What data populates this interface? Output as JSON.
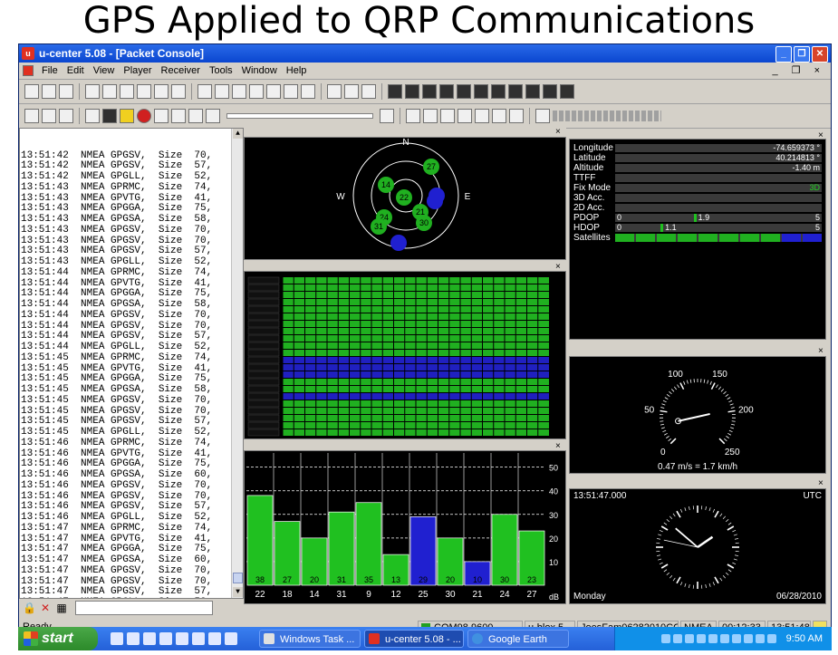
{
  "slide": {
    "title": "GPS Applied to QRP Communications"
  },
  "window": {
    "title": "u-center 5.08 - [Packet Console]",
    "app_icon": "u",
    "buttons": [
      "_",
      "❐",
      "✕"
    ],
    "menu": [
      "File",
      "Edit",
      "View",
      "Player",
      "Receiver",
      "Tools",
      "Window",
      "Help"
    ],
    "mdi_controls": "_ ❐ ×"
  },
  "console": {
    "lines": [
      "13:51:42  NMEA GPGSV,  Size  70,",
      "13:51:42  NMEA GPGSV,  Size  57,",
      "13:51:42  NMEA GPGLL,  Size  52,",
      "13:51:43  NMEA GPRMC,  Size  74,",
      "13:51:43  NMEA GPVTG,  Size  41,",
      "13:51:43  NMEA GPGGA,  Size  75,",
      "13:51:43  NMEA GPGSA,  Size  58,",
      "13:51:43  NMEA GPGSV,  Size  70,",
      "13:51:43  NMEA GPGSV,  Size  70,",
      "13:51:43  NMEA GPGSV,  Size  57,",
      "13:51:43  NMEA GPGLL,  Size  52,",
      "13:51:44  NMEA GPRMC,  Size  74,",
      "13:51:44  NMEA GPVTG,  Size  41,",
      "13:51:44  NMEA GPGGA,  Size  75,",
      "13:51:44  NMEA GPGSA,  Size  58,",
      "13:51:44  NMEA GPGSV,  Size  70,",
      "13:51:44  NMEA GPGSV,  Size  70,",
      "13:51:44  NMEA GPGSV,  Size  57,",
      "13:51:44  NMEA GPGLL,  Size  52,",
      "13:51:45  NMEA GPRMC,  Size  74,",
      "13:51:45  NMEA GPVTG,  Size  41,",
      "13:51:45  NMEA GPGGA,  Size  75,",
      "13:51:45  NMEA GPGSA,  Size  58,",
      "13:51:45  NMEA GPGSV,  Size  70,",
      "13:51:45  NMEA GPGSV,  Size  70,",
      "13:51:45  NMEA GPGSV,  Size  57,",
      "13:51:45  NMEA GPGLL,  Size  52,",
      "13:51:46  NMEA GPRMC,  Size  74,",
      "13:51:46  NMEA GPVTG,  Size  41,",
      "13:51:46  NMEA GPGGA,  Size  75,",
      "13:51:46  NMEA GPGSA,  Size  60,",
      "13:51:46  NMEA GPGSV,  Size  70,",
      "13:51:46  NMEA GPGSV,  Size  70,",
      "13:51:46  NMEA GPGSV,  Size  57,",
      "13:51:46  NMEA GPGLL,  Size  52,",
      "13:51:47  NMEA GPRMC,  Size  74,",
      "13:51:47  NMEA GPVTG,  Size  41,",
      "13:51:47  NMEA GPGGA,  Size  75,",
      "13:51:47  NMEA GPGSA,  Size  60,",
      "13:51:47  NMEA GPGSV,  Size  70,",
      "13:51:47  NMEA GPGSV,  Size  70,",
      "13:51:47  NMEA GPGSV,  Size  57,",
      "13:51:47  NMEA GPGLL,  Size  52,"
    ]
  },
  "skyview": {
    "directions": [
      "N",
      "E",
      "W"
    ],
    "satellites": [
      {
        "id": "27",
        "color": "#20b020"
      },
      {
        "id": "14",
        "color": "#20b020"
      },
      {
        "id": "22",
        "color": "#20b020"
      },
      {
        "id": "24",
        "color": "#20b020"
      },
      {
        "id": "21",
        "color": "#20b020"
      },
      {
        "id": "31",
        "color": "#20b020"
      },
      {
        "id": "30",
        "color": "#20b020"
      },
      {
        "id": "",
        "color": "#2020d0"
      },
      {
        "id": "",
        "color": "#2020d0"
      },
      {
        "id": "",
        "color": "#2020d0"
      }
    ]
  },
  "datapanel": {
    "rows": [
      {
        "label": "Longitude",
        "value": "-74.659373 °"
      },
      {
        "label": "Latitude",
        "value": "40.214813 °"
      },
      {
        "label": "Altitude",
        "value": "-1.40 m"
      },
      {
        "label": "TTFF",
        "value": ""
      },
      {
        "label": "Fix Mode",
        "value": "3D"
      },
      {
        "label": "3D Acc.",
        "value": ""
      },
      {
        "label": "2D Acc.",
        "value": ""
      },
      {
        "label": "PDOP",
        "value": "1.9",
        "min": "0",
        "max": "5",
        "level": 0.38
      },
      {
        "label": "HDOP",
        "value": "1.1",
        "min": "0",
        "max": "5",
        "level": 0.22
      },
      {
        "label": "Satellites",
        "value": ""
      }
    ],
    "satellite_cells": [
      "#20b020",
      "#20b020",
      "#20b020",
      "#20b020",
      "#20b020",
      "#20b020",
      "#20b020",
      "#20b020",
      "#2020d0",
      "#2020d0"
    ]
  },
  "speedometer": {
    "ticks": [
      "0",
      "50",
      "100",
      "150",
      "200",
      "250"
    ],
    "readout": "0.47 m/s = 1.7 km/h",
    "speed_kmh": 1.7
  },
  "clock": {
    "time": "13:51:47.000",
    "zone": "UTC",
    "day": "Monday",
    "date": "06/28/2010",
    "hour": 1,
    "minute": 51,
    "second": 47
  },
  "cn_chart": {
    "yticks": [
      "50",
      "40",
      "30",
      "20",
      "10"
    ],
    "unit": "dB",
    "ylim": [
      0,
      56
    ],
    "bars": [
      {
        "sv": "22",
        "cn": 38,
        "color": "#20c020"
      },
      {
        "sv": "18",
        "cn": 27,
        "color": "#20c020"
      },
      {
        "sv": "14",
        "cn": 20,
        "color": "#20c020"
      },
      {
        "sv": "31",
        "cn": 31,
        "color": "#20c020"
      },
      {
        "sv": "9",
        "cn": 35,
        "color": "#20c020"
      },
      {
        "sv": "12",
        "cn": 13,
        "color": "#20c020"
      },
      {
        "sv": "25",
        "cn": 29,
        "color": "#2020d0"
      },
      {
        "sv": "30",
        "cn": 20,
        "color": "#20c020"
      },
      {
        "sv": "21",
        "cn": 10,
        "color": "#2020d0"
      },
      {
        "sv": "24",
        "cn": 30,
        "color": "#20c020"
      },
      {
        "sv": "27",
        "cn": 23,
        "color": "#20c020"
      }
    ]
  },
  "status": {
    "ready": "Ready",
    "port": "COM98 9600",
    "receiver": "u-blox 5",
    "file": "JoesFam06282010CON",
    "protocol": "NMEA",
    "elapsed": "00:12:33",
    "clock": "13:51:48"
  },
  "taskbar": {
    "start": "start",
    "items": [
      {
        "label": "Windows Task ...",
        "active": false
      },
      {
        "label": "u-center 5.08 - ...",
        "active": true
      },
      {
        "label": "Google Earth",
        "active": false
      }
    ],
    "time": "9:50 AM"
  },
  "colors": {
    "titlebar": "#0a46d0",
    "good": "#20b020",
    "unused": "#2020d0"
  }
}
